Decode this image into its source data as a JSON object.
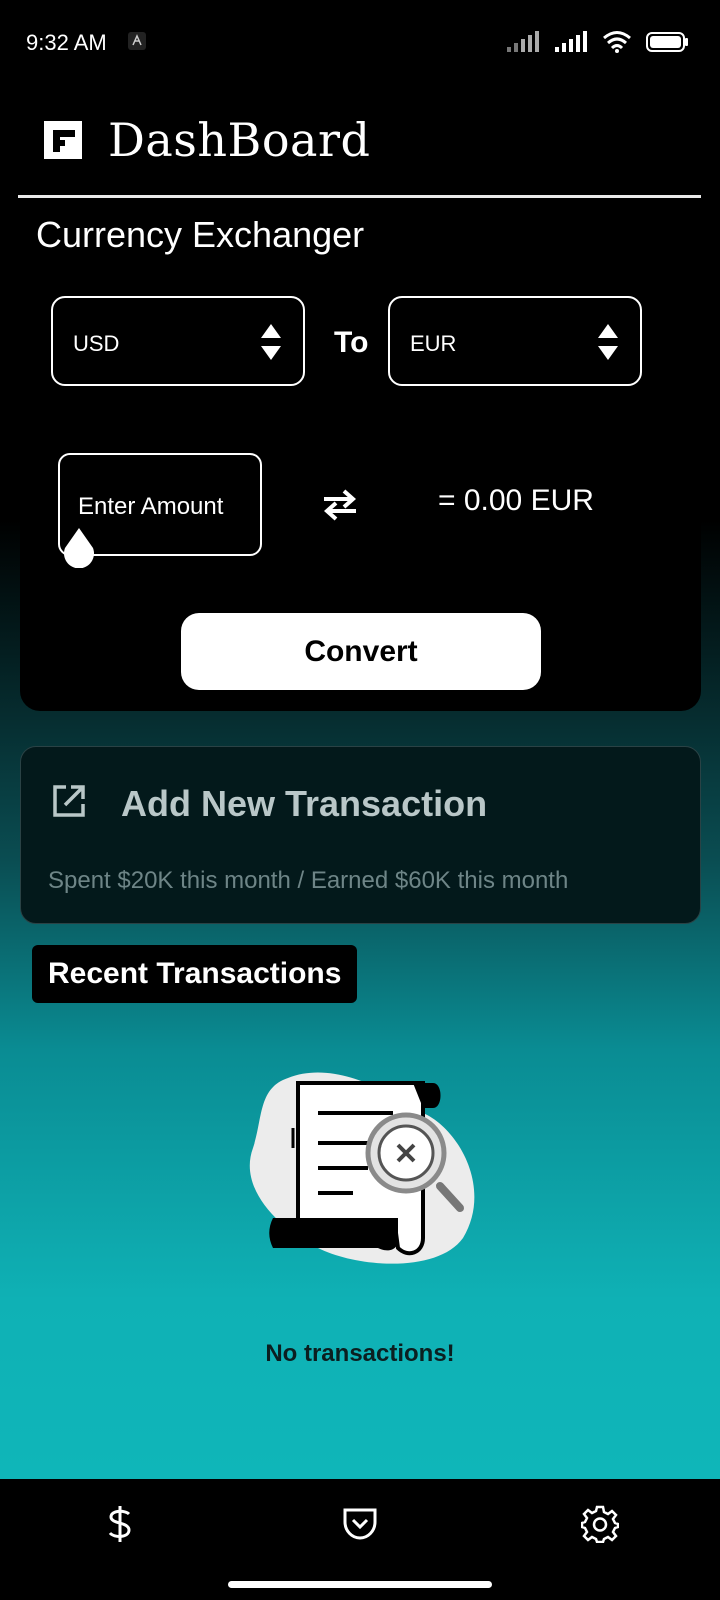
{
  "status_bar": {
    "time": "9:32 AM"
  },
  "header": {
    "title": "DashBoard"
  },
  "exchanger": {
    "title": "Currency Exchanger",
    "from_currency": "USD",
    "to_label": "To",
    "to_currency": "EUR",
    "amount_placeholder": "Enter Amount",
    "result": "= 0.00 EUR",
    "convert_label": "Convert"
  },
  "transaction_card": {
    "title": "Add New Transaction",
    "stats": "Spent $20K this month  /   Earned $60K this month"
  },
  "recent": {
    "title": "Recent Transactions",
    "empty_message": "No transactions!"
  },
  "bottom_nav": {
    "items": [
      {
        "icon": "dollar-icon"
      },
      {
        "icon": "pocket-icon"
      },
      {
        "icon": "gear-icon"
      }
    ]
  },
  "colors": {
    "background_top": "#000000",
    "background_bottom": "#0fb6b9",
    "card": "#000000",
    "transaction_card": "#03191b",
    "button": "#ffffff"
  }
}
